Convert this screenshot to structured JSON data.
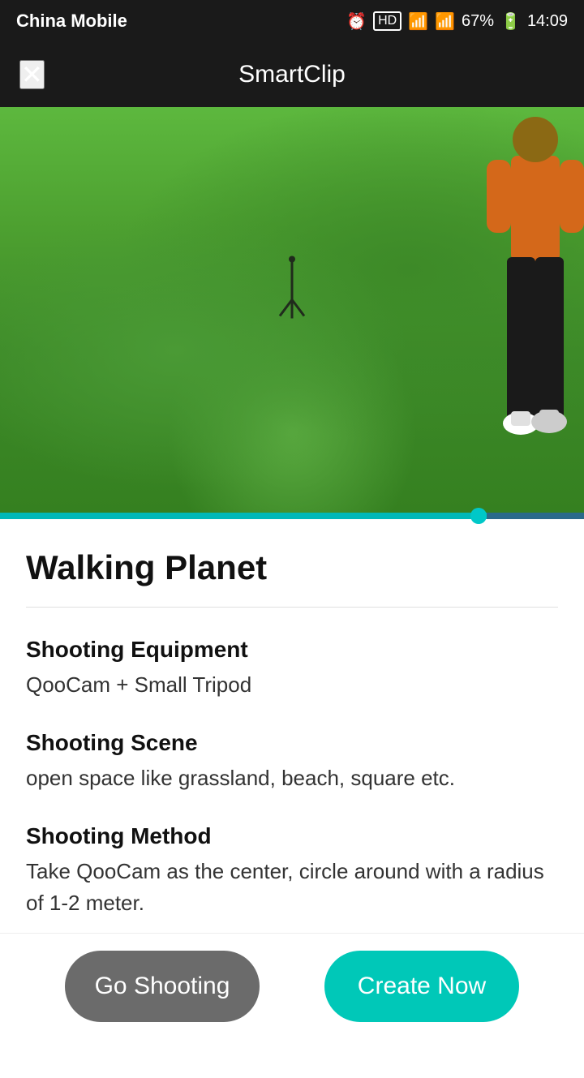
{
  "statusBar": {
    "carrier": "China Mobile",
    "time": "14:09",
    "battery": "67%"
  },
  "header": {
    "title": "SmartClip",
    "closeIcon": "×"
  },
  "content": {
    "title": "Walking Planet",
    "shootingEquipmentLabel": "Shooting Equipment",
    "shootingEquipmentValue": "QooCam + Small Tripod",
    "shootingSceneLabel": "Shooting Scene",
    "shootingSceneValue": "open space like grassland, beach, square etc.",
    "shootingMethodLabel": "Shooting Method",
    "shootingMethodValue": "Take QooCam as the center, circle around with a radius of 1-2 meter."
  },
  "buttons": {
    "goShooting": "Go Shooting",
    "createNow": "Create Now"
  },
  "colors": {
    "accent": "#00c8b8",
    "buttonGray": "#6b6b6b",
    "headerBg": "#1a1a1a"
  }
}
